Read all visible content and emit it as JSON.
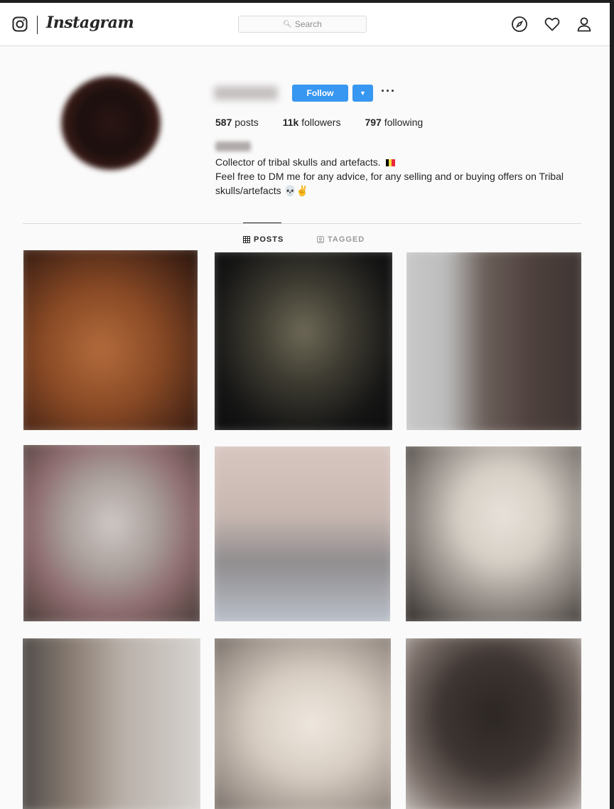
{
  "header": {
    "brand": "Instagram",
    "search_placeholder": "Search",
    "icons": [
      "instagram-glyph-icon",
      "search-icon",
      "compass-icon",
      "heart-icon",
      "user-icon"
    ]
  },
  "profile": {
    "follow_label": "Follow",
    "dropdown_glyph": "▼",
    "more_glyph": "···",
    "stats": {
      "posts_count": "587",
      "posts_label": "posts",
      "followers_count": "11k",
      "followers_label": "followers",
      "following_count": "797",
      "following_label": "following"
    },
    "bio_line1": "Collector of tribal skulls and artefacts.",
    "bio_line2": "Feel free to DM me for any advice, for any selling and or buying offers on Tribal",
    "bio_line3": "skulls/artefacts 💀✌"
  },
  "tabs": {
    "posts": "POSTS",
    "tagged": "TAGGED",
    "active": "posts"
  },
  "colors": {
    "accent": "#3897f0",
    "text": "#262626",
    "muted": "#8e8e8e",
    "border": "#dbdbdb",
    "background": "#fafafa"
  }
}
